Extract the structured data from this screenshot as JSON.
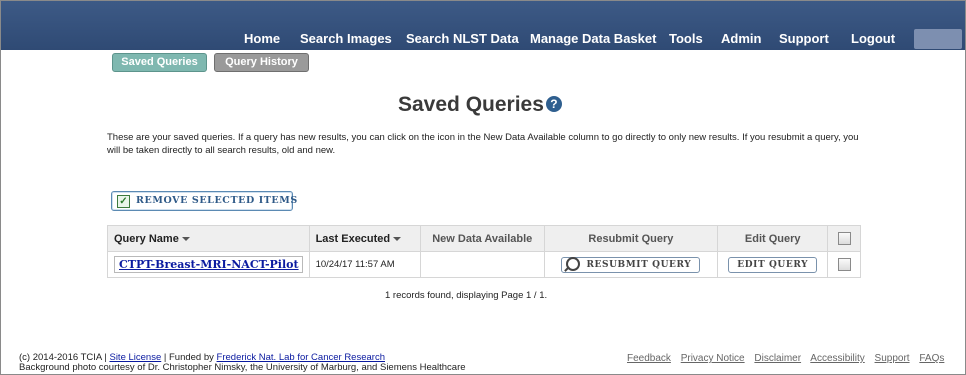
{
  "nav": {
    "items": [
      "Home",
      "Search Images",
      "Search NLST Data",
      "Manage Data Basket",
      "Tools",
      "Admin",
      "Support",
      "Logout"
    ]
  },
  "tabs": [
    "Saved Queries",
    "Query History"
  ],
  "page": {
    "title": "Saved Queries",
    "help_glyph": "?",
    "intro": "These are your saved queries. If a query has new results, you can click on the icon in the New Data Available column to go directly to only new results. If you resubmit a query, you will be taken directly to all search results, old and new."
  },
  "remove_button": {
    "label": "REMOVE SELECTED ITEMS",
    "check_glyph": "✓"
  },
  "table": {
    "headers": [
      "Query Name",
      "Last Executed",
      "New Data Available",
      "Resubmit Query",
      "Edit Query"
    ],
    "rows": [
      {
        "query_name": "CTPT-Breast-MRI-NACT-Pilot",
        "last_executed": "10/24/17 11:57 AM",
        "new_data": "",
        "resubmit_label": "RESUBMIT QUERY",
        "edit_label": "EDIT QUERY"
      }
    ],
    "records_text": "1 records found, displaying Page 1 / 1."
  },
  "footer": {
    "copyright": "(c) 2014-2016 TCIA |",
    "site_license": "Site License",
    "funded_by": "| Funded by",
    "funder": "Frederick Nat. Lab for Cancer Research",
    "photo_credit": "Background photo courtesy of Dr. Christopher Nimsky, the University of Marburg, and Siemens Healthcare",
    "links": [
      "Feedback",
      "Privacy Notice",
      "Disclaimer",
      "Accessibility",
      "Support",
      "FAQs"
    ]
  },
  "colors": {
    "navbar": "#34507c",
    "tab_active": "#7fb8b0",
    "tab_inactive": "#9a9a9a",
    "link": "#0a1aa0"
  }
}
